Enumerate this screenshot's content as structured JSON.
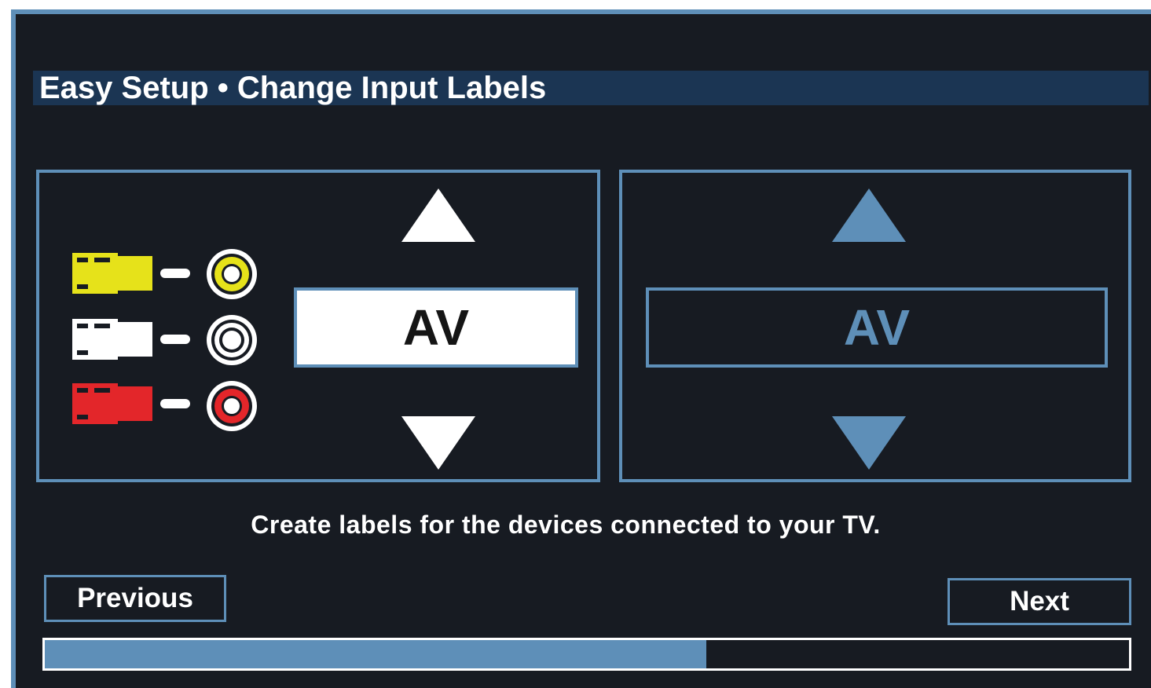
{
  "header": {
    "title": "Easy Setup • Change Input Labels"
  },
  "input_panel": {
    "icons": [
      "rca-yellow-plug",
      "rca-white-plug",
      "rca-red-plug",
      "rca-yellow-jack",
      "rca-white-jack",
      "rca-red-jack"
    ],
    "current_label": "AV",
    "up_icon": "triangle-up",
    "down_icon": "triangle-down"
  },
  "preview_panel": {
    "label": "AV",
    "up_icon": "triangle-up",
    "down_icon": "triangle-down"
  },
  "hint": "Create labels for the devices connected to your TV.",
  "nav": {
    "previous_label": "Previous",
    "next_label": "Next"
  },
  "progress": {
    "fraction": 0.61
  },
  "colors": {
    "background": "#171b22",
    "accent": "#5e8fb8",
    "title_bar": "#1b3553",
    "rca_yellow": "#e6e21a",
    "rca_white": "#ffffff",
    "rca_red": "#e3262a"
  }
}
